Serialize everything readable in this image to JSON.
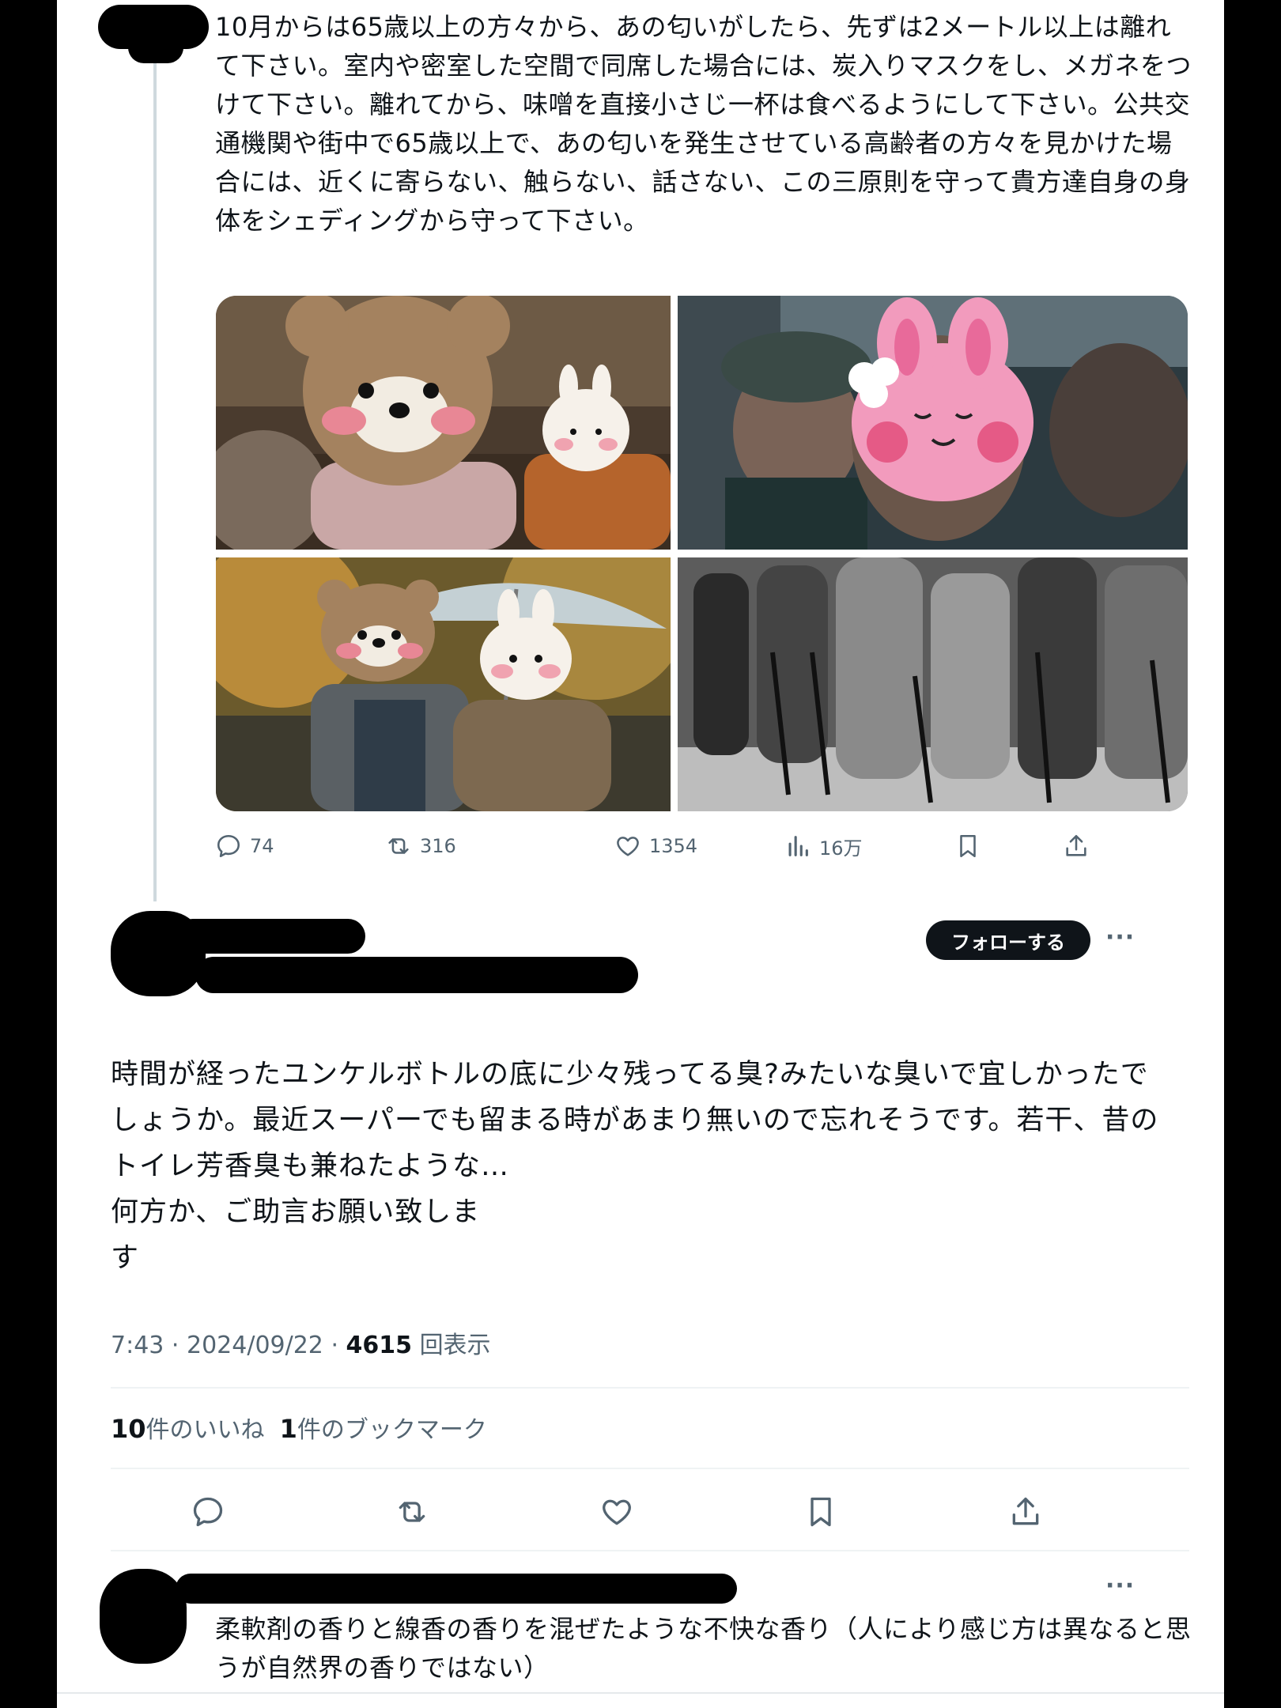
{
  "quoted_tweet": {
    "text": "10月からは65歳以上の方々から、あの匂いがしたら、先ずは2メートル以上は離れて下さい。室内や密室した空間で同席した場合には、炭入りマスクをし、メガネをつけて下さい。離れてから、味噌を直接小さじ一杯は食べるようにして下さい。公共交通機関や街中で65歳以上で、あの匂いを発生させている高齢者の方々を見かけた場合には、近くに寄らない、触らない、話さない、この三原則を守って貴方達自身の身体をシェディングから守って下さい。",
    "actions": {
      "reply_count": "74",
      "retweet_count": "316",
      "like_count": "1354",
      "views_count": "16万"
    },
    "media": [
      "bear-sticker-photo",
      "bunny-sticker-photo",
      "umbrella-couple-photo",
      "walkers-bw-photo"
    ]
  },
  "reply": {
    "follow_label": "フォローする",
    "more_label": "···",
    "text": "時間が経ったユンケルボトルの底に少々残ってる臭?みたいな臭いで宜しかったでしょうか。最近スーパーでも留まる時があまり無いので忘れそうです。若干、昔のトイレ芳香臭も兼ねたような…\n何方か、ご助言お願い致しま\nす",
    "time": "7:43",
    "date": "2024/09/22",
    "views_count": "4615",
    "views_label": "回表示",
    "like_count": "10",
    "like_label": "件のいいね",
    "bookmark_count": "1",
    "bookmark_label": "件のブックマーク"
  },
  "next_reply": {
    "more_label": "···",
    "text": "柔軟剤の香りと線香の香りを混ぜたような不快な香り（人により感じ方は異なると思うが自然界の香りではない）"
  },
  "colors": {
    "text": "#0f1419",
    "secondary": "#536471",
    "divider": "#eff3f4",
    "button_bg": "#0f1419"
  },
  "icons": [
    "reply-icon",
    "retweet-icon",
    "like-icon",
    "views-icon",
    "bookmark-icon",
    "share-icon",
    "more-icon"
  ]
}
